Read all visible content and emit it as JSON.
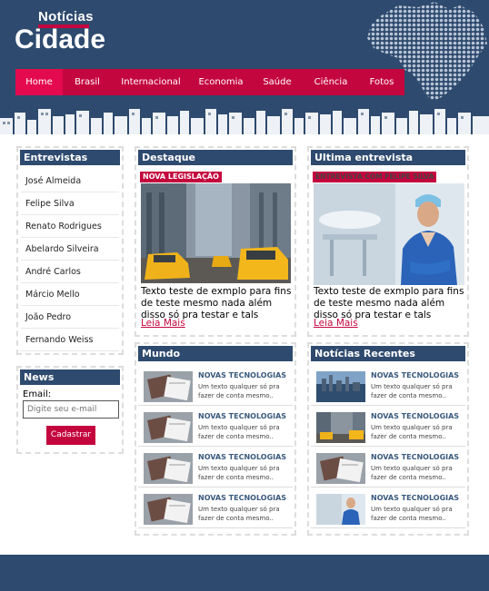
{
  "header": {
    "logo_small": "Notícias",
    "logo_big": "Cidade",
    "nav": [
      "Home",
      "Brasil",
      "Internacional",
      "Economia",
      "Saúde",
      "Ciência",
      "Fotos"
    ]
  },
  "entrevistas": {
    "title": "Entrevistas",
    "items": [
      "José Almeida",
      "Felipe Silva",
      "Renato Rodrigues",
      "Abelardo Silveira",
      "André Carlos",
      "Márcio Mello",
      "João Pedro",
      "Fernando Weiss"
    ]
  },
  "news": {
    "title": "News",
    "email_label": "Email:",
    "email_placeholder": "Digite seu e-mail",
    "button": "Cadastrar"
  },
  "destaque": {
    "title": "Destaque",
    "tag": "NOVA LEGISLAÇÃO",
    "text": "Texto teste de exmplo para fins de teste mesmo nada além disso só pra testar e tals",
    "link": "Leia Mais",
    "image": "city-street-taxis-photo"
  },
  "ultima": {
    "title": "Ultima entrevista",
    "tag": "ENTREVISTA COM FELIPE SILVA",
    "text": "Texto teste de exmplo para fins de teste mesmo nada além disso só pra testar e tals",
    "link": "Leia Mais",
    "image": "doctor-portrait-photo"
  },
  "mundo": {
    "title": "Mundo",
    "items": [
      {
        "title": "NOVAS TECNOLOGIAS",
        "desc": "Um texto qualquer só pra fazer de conta mesmo..",
        "thumb": "notebook-photo"
      },
      {
        "title": "NOVAS TECNOLOGIAS",
        "desc": "Um texto qualquer só pra fazer de conta mesmo..",
        "thumb": "notebook-photo"
      },
      {
        "title": "NOVAS TECNOLOGIAS",
        "desc": "Um texto qualquer só pra fazer de conta mesmo..",
        "thumb": "notebook-photo"
      },
      {
        "title": "NOVAS TECNOLOGIAS",
        "desc": "Um texto qualquer só pra fazer de conta mesmo..",
        "thumb": "notebook-photo"
      }
    ]
  },
  "recentes": {
    "title": "Notícias Recentes",
    "items": [
      {
        "title": "NOVAS TECNOLOGIAS",
        "desc": "Um texto qualquer só pra fazer de conta mesmo..",
        "thumb": "skyline-photo"
      },
      {
        "title": "NOVAS TECNOLOGIAS",
        "desc": "Um texto qualquer só pra fazer de conta mesmo..",
        "thumb": "street-taxis-photo"
      },
      {
        "title": "NOVAS TECNOLOGIAS",
        "desc": "Um texto qualquer só pra fazer de conta mesmo..",
        "thumb": "notebook-photo"
      },
      {
        "title": "NOVAS TECNOLOGIAS",
        "desc": "Um texto qualquer só pra fazer de conta mesmo..",
        "thumb": "doctor-photo"
      }
    ]
  },
  "colors": {
    "primary": "#2e4a6e",
    "accent": "#c4063e",
    "accent_active": "#e40a4f"
  }
}
